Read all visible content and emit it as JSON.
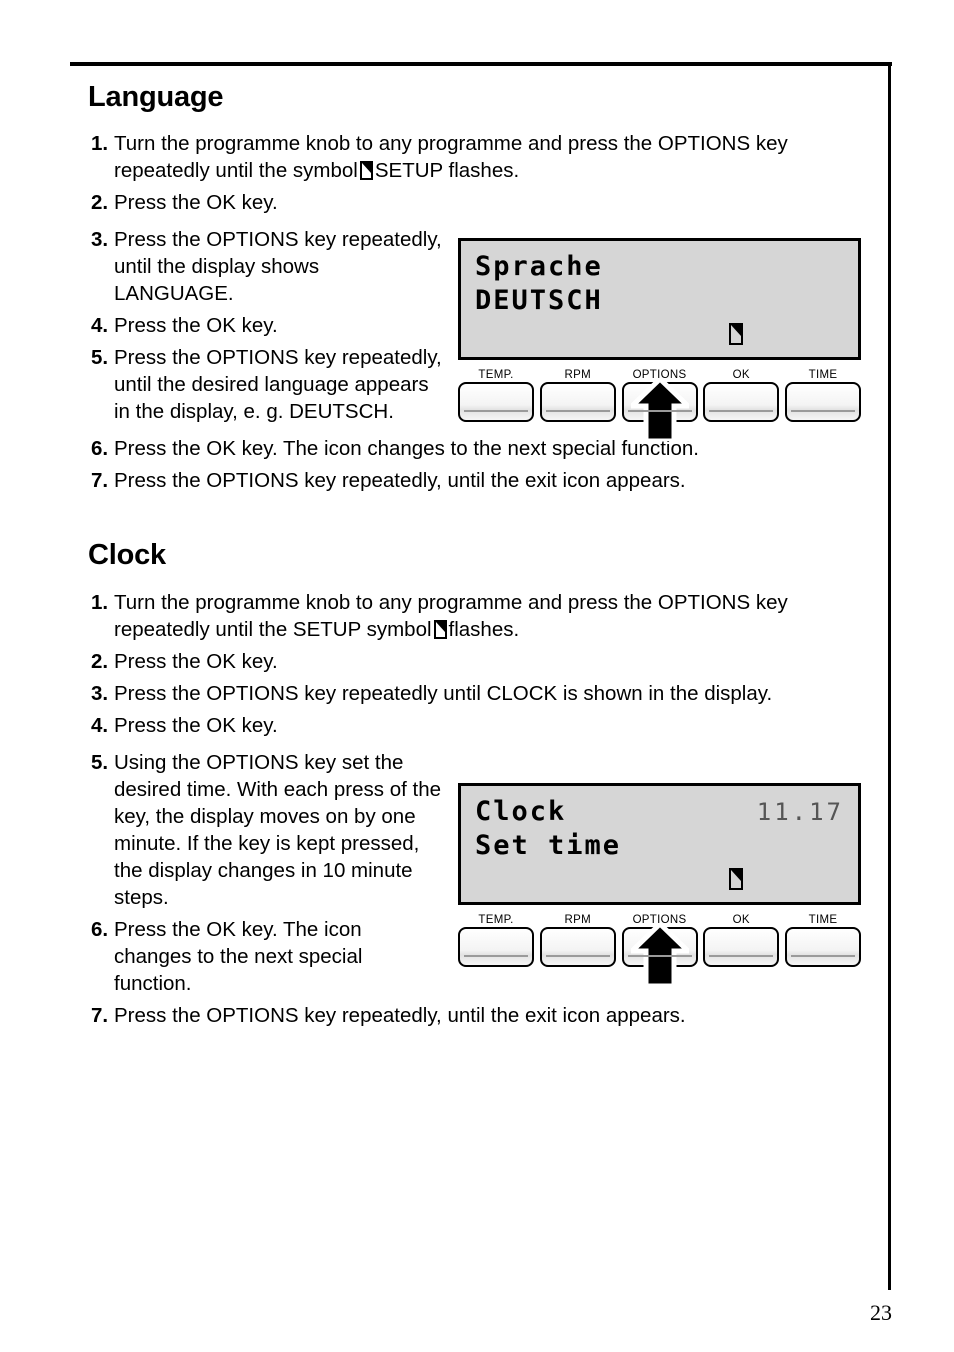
{
  "page": {
    "number": "23"
  },
  "sections": [
    {
      "id": "language",
      "title": "Language",
      "steps": [
        {
          "num": "1.",
          "text_before": "Turn the programme knob to any programme and press the OPTIONS key repeatedly until the symbol",
          "icon": "setup-symbol",
          "text_after": "SETUP flashes.",
          "narrow": false
        },
        {
          "num": "2.",
          "text": "Press the OK key.",
          "narrow": false
        },
        {
          "num": "3.",
          "text": "Press the OPTIONS key repeatedly, until the display shows LANGUAGE.",
          "narrow": true
        },
        {
          "num": "4.",
          "text": "Press the OK key.",
          "narrow": true
        },
        {
          "num": "5.",
          "text": "Press the OPTIONS key repeatedly, until the desired language appears in the display, e. g. DEUTSCH.",
          "narrow": true
        },
        {
          "num": "6.",
          "text": "Press the OK key. The icon changes to the next special function.",
          "narrow": false
        },
        {
          "num": "7.",
          "text": "Press the OPTIONS key repeatedly, until the exit icon appears.",
          "narrow": false
        }
      ]
    },
    {
      "id": "clock",
      "title": "Clock",
      "steps": [
        {
          "num": "1.",
          "text_before": "Turn the programme knob to any programme and press the OPTIONS key repeatedly until the SETUP symbol",
          "icon": "setup-symbol",
          "text_after": "flashes.",
          "narrow": false
        },
        {
          "num": "2.",
          "text": "Press the OK key.",
          "narrow": false
        },
        {
          "num": "3.",
          "text": "Press the OPTIONS key repeatedly until CLOCK is shown in the display.",
          "narrow": false
        },
        {
          "num": "4.",
          "text": "Press the OK key.",
          "narrow": false
        },
        {
          "num": "5.",
          "text": "Using the OPTIONS key set the desired time. With each press of the key, the display moves on by one minute. If the key is kept pressed, the display changes in 10 minute steps.",
          "narrow": true
        },
        {
          "num": "6.",
          "text": "Press the OK key. The icon changes to the next special function.",
          "narrow": true
        },
        {
          "num": "7.",
          "text": "Press the OPTIONS key repeatedly, until the exit icon appears.",
          "narrow": false
        }
      ]
    }
  ],
  "panels": [
    {
      "id": "language-panel",
      "lcd": {
        "line1": "Sprache",
        "line2": "DEUTSCH",
        "time": "",
        "icon": "setup-icon"
      },
      "keys": [
        {
          "label": "TEMP.",
          "name": "temp-key",
          "highlighted": false
        },
        {
          "label": "RPM",
          "name": "rpm-key",
          "highlighted": false
        },
        {
          "label": "OPTIONS",
          "name": "options-key",
          "highlighted": true
        },
        {
          "label": "OK",
          "name": "ok-key",
          "highlighted": false
        },
        {
          "label": "TIME",
          "name": "time-key",
          "highlighted": false
        }
      ]
    },
    {
      "id": "clock-panel",
      "lcd": {
        "line1": "Clock",
        "line2": "Set time",
        "time": "11.17",
        "icon": "setup-icon"
      },
      "keys": [
        {
          "label": "TEMP.",
          "name": "temp-key",
          "highlighted": false
        },
        {
          "label": "RPM",
          "name": "rpm-key",
          "highlighted": false
        },
        {
          "label": "OPTIONS",
          "name": "options-key",
          "highlighted": true
        },
        {
          "label": "OK",
          "name": "ok-key",
          "highlighted": false
        },
        {
          "label": "TIME",
          "name": "time-key",
          "highlighted": false
        }
      ]
    }
  ],
  "colors": {
    "lcd_background": "#d6d6d6",
    "ink": "#000000",
    "page_background": "#ffffff"
  }
}
